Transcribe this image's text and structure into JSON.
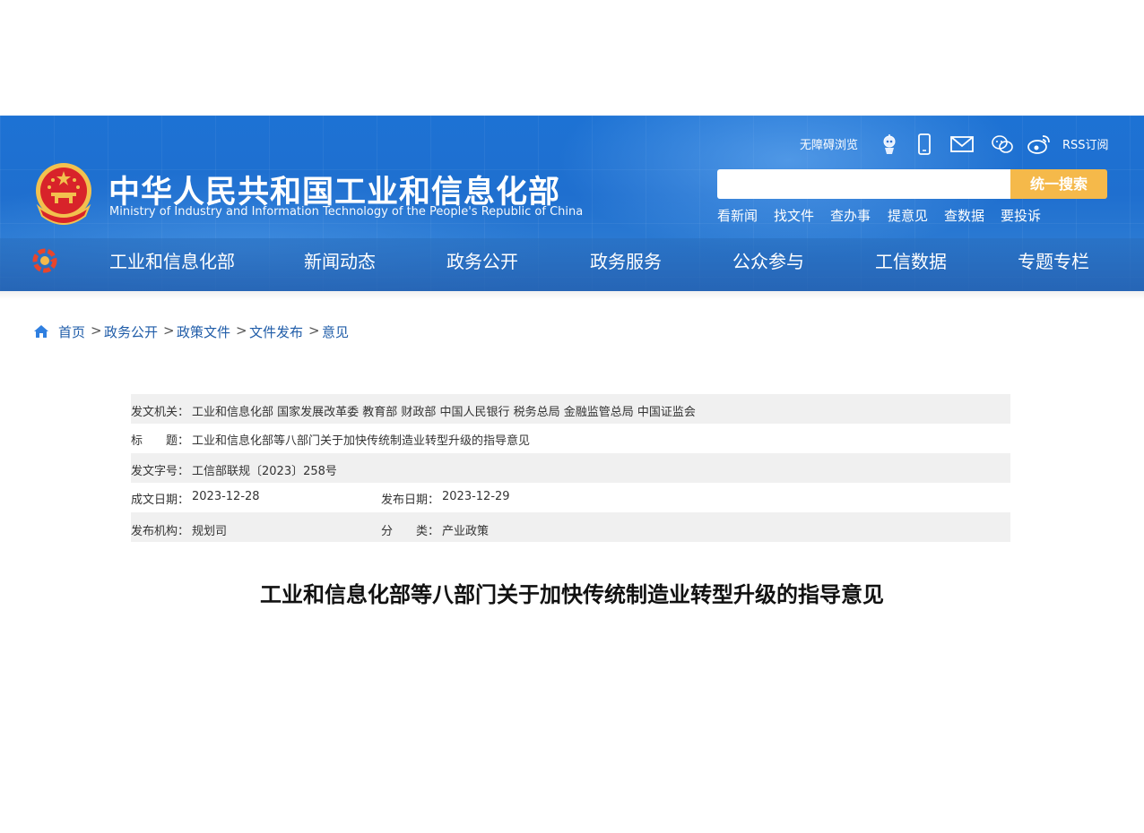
{
  "header": {
    "title": "中华人民共和国工业和信息化部",
    "subtitle": "Ministry of Industry and Information Technology of the People's Republic of China",
    "accessibility": "无障碍浏览",
    "rss": "RSS订阅",
    "search_placeholder": "",
    "search_button": "统一搜索",
    "quick_links": [
      "看新闻",
      "找文件",
      "查办事",
      "提意见",
      "查数据",
      "要投诉"
    ],
    "nav": [
      "工业和信息化部",
      "新闻动态",
      "政务公开",
      "政务服务",
      "公众参与",
      "工信数据",
      "专题专栏"
    ]
  },
  "breadcrumb": [
    "首页",
    "政务公开",
    "政策文件",
    "文件发布",
    "意见"
  ],
  "breadcrumb_sep": ">",
  "meta": {
    "issuer_label": "发文机关：",
    "issuer_value": "工业和信息化部 国家发展改革委 教育部 财政部 中国人民银行 税务总局 金融监管总局 中国证监会",
    "title_label": "标　　题：",
    "title_value": "工业和信息化部等八部门关于加快传统制造业转型升级的指导意见",
    "docno_label": "发文字号：",
    "docno_value": "工信部联规〔2023〕258号",
    "written_label": "成文日期：",
    "written_value": "2023-12-28",
    "published_label": "发布日期：",
    "published_value": "2023-12-29",
    "org_label": "发布机构：",
    "org_value": "规划司",
    "category_label": "分　　类：",
    "category_value": "产业政策"
  },
  "doc_title": "工业和信息化部等八部门关于加快传统制造业转型升级的指导意见",
  "colors": {
    "header_blue": "#1f6fcf",
    "search_button": "#f5b94a",
    "link_blue": "#1f5ca8",
    "row_shade": "#f0f0f0"
  }
}
